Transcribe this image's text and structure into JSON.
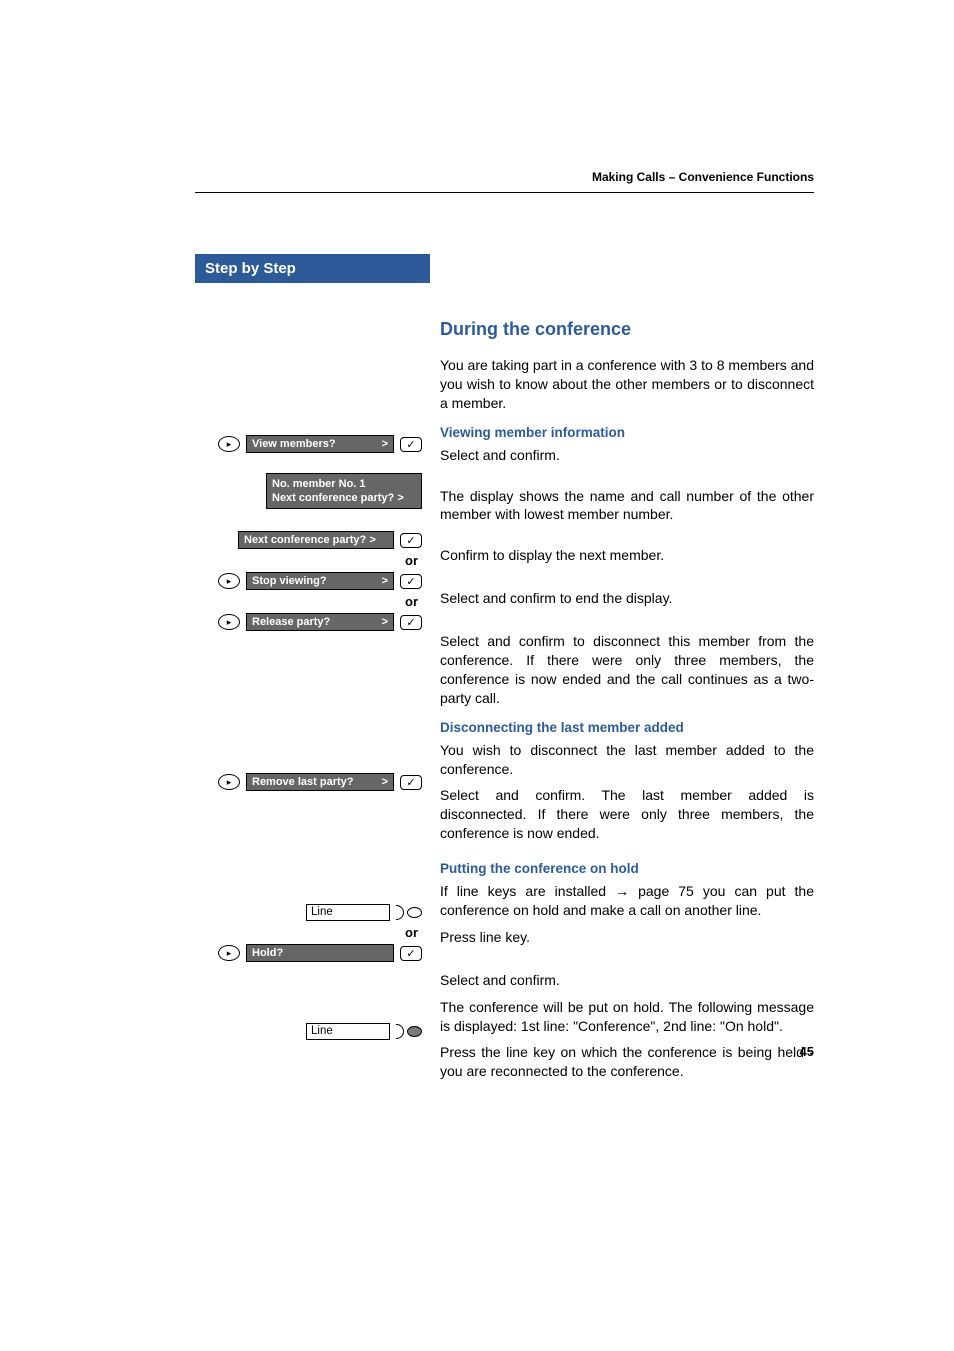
{
  "running_header": "Making Calls – Convenience Functions",
  "step_header": "Step by Step",
  "page_number": "45",
  "section": {
    "title": "During the conference",
    "intro": "You are taking part in a conference with 3 to 8 members and you wish to know about the other members or to disconnect a member.",
    "sub1": {
      "head": "Viewing member information",
      "select1": "Select and confirm.",
      "info1": "The display shows the name and call number of the other member with lowest member number.",
      "confirm_next": "Confirm to display the next member.",
      "stop": "Select and confirm to end the display.",
      "release": "Select and confirm to disconnect this member from the conference. If there were only three members, the conference is now ended and the call continues as a two-party call."
    },
    "sub2": {
      "head": "Disconnecting the last member added",
      "wish": "You wish to disconnect the last member added to the conference.",
      "remove": "Select and confirm. The last member added is disconnected. If there were only three members, the conference is now ended."
    },
    "sub3": {
      "head": "Putting the conference on hold",
      "ifline": "If line keys are installed → page 75 you can put the conference on hold and make a call on another line.",
      "press_line": "Press line key.",
      "select_hold": "Select and confirm.",
      "onhold": "The conference will be put on hold. The following message is displayed: 1st line:  \"Conference\", 2nd line: \"On hold\".",
      "press_line2": "Press the line key on which the conference is being held - you are reconnected to the conference."
    }
  },
  "left": {
    "view_members": "View members?",
    "arrow": ">",
    "no_member": "No. member No.   1",
    "next_party": "Next conference party? >",
    "or": "or",
    "stop_viewing": "Stop viewing?",
    "release_party": "Release party?",
    "remove_last": "Remove last party?",
    "line": "Line",
    "hold": "Hold?",
    "check": "✓",
    "play": "▸"
  }
}
